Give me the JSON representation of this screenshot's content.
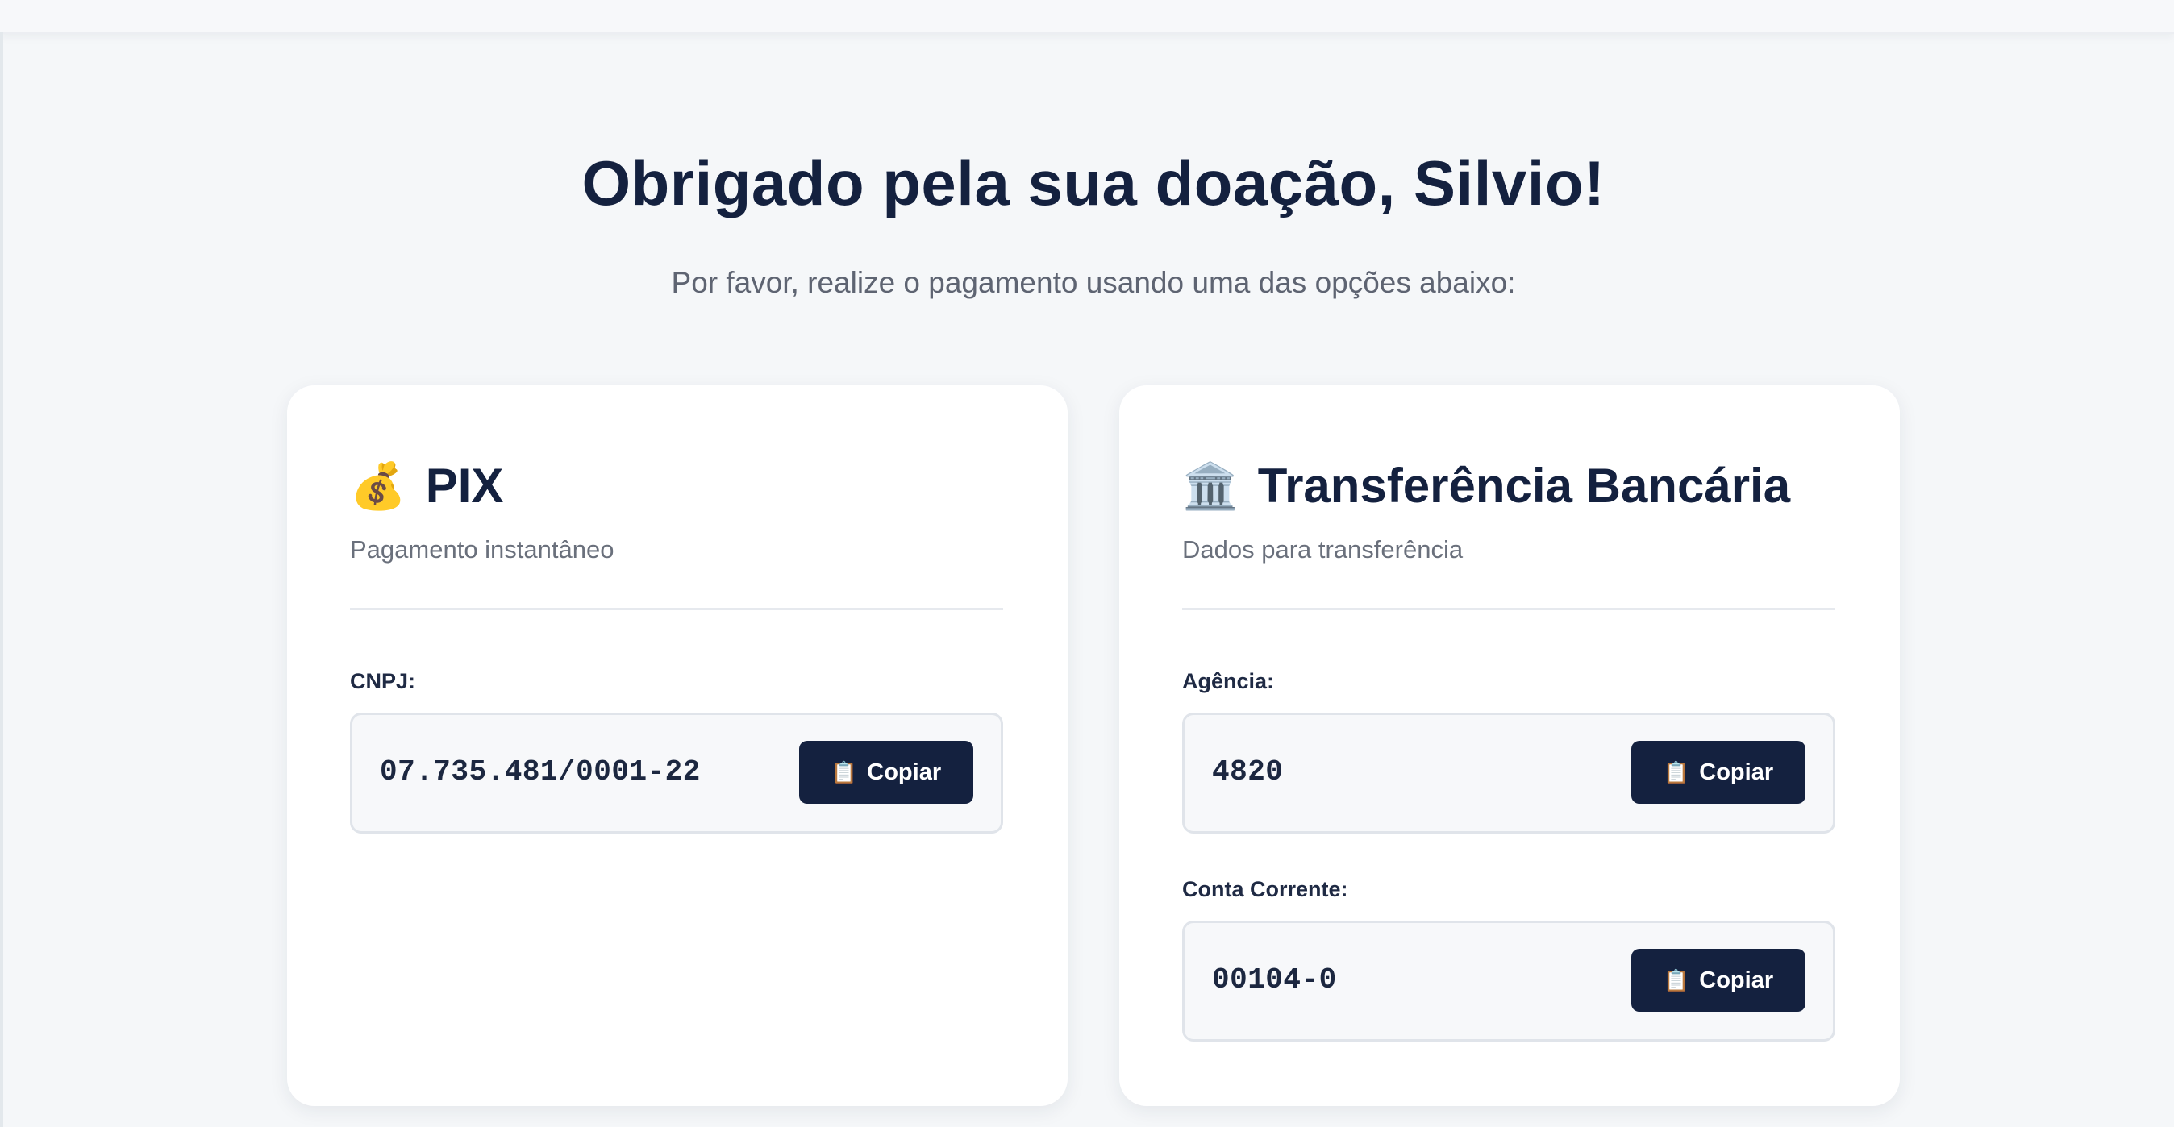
{
  "header": {
    "title": "Obrigado pela sua doação, Silvio!",
    "subtitle": "Por favor, realize o pagamento usando uma das opções abaixo:"
  },
  "cards": [
    {
      "icon": "money-bag-icon",
      "icon_glyph": "💰",
      "title": "PIX",
      "subtitle": "Pagamento instantâneo",
      "fields": [
        {
          "label": "CNPJ:",
          "value": "07.735.481/0001-22",
          "button_label": "Copiar"
        }
      ]
    },
    {
      "icon": "bank-icon",
      "icon_glyph": "🏛️",
      "title": "Transferência Bancária",
      "subtitle": "Dados para transferência",
      "fields": [
        {
          "label": "Agência:",
          "value": "4820",
          "button_label": "Copiar"
        },
        {
          "label": "Conta Corrente:",
          "value": "00104-0",
          "button_label": "Copiar"
        }
      ]
    }
  ],
  "copy_icon_glyph": "📋",
  "colors": {
    "primary": "#14213f",
    "background": "#f5f7f9",
    "card": "#ffffff",
    "muted_text": "#5e6472"
  }
}
